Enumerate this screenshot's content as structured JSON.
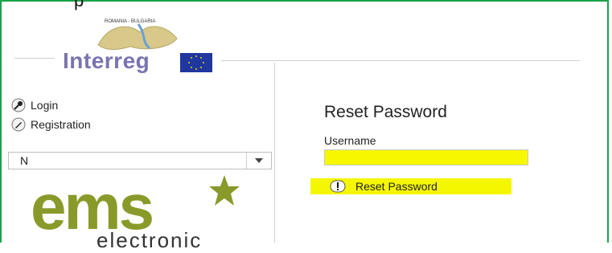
{
  "header": {
    "logo_brand": "Interreg",
    "logo_map_caption": "ROMANIA - BULGARIA",
    "eu_flag_icon": "eu-flag-icon",
    "top_glyph": "p"
  },
  "sidebar": {
    "items": [
      {
        "label": "Login",
        "icon": "login-key-icon"
      },
      {
        "label": "Registration",
        "icon": "registration-pen-icon"
      }
    ],
    "language_select": {
      "value": "N"
    }
  },
  "ems_logo": {
    "main": "ems",
    "sub": "electronic"
  },
  "form": {
    "title": "Reset Password",
    "username_label": "Username",
    "username_value": "",
    "reset_button_label": "Reset Password"
  },
  "colors": {
    "frame": "#1aa34a",
    "highlight": "#f5f700",
    "brand_purple": "#7a74b0",
    "ems_green": "#8a9a2a"
  }
}
